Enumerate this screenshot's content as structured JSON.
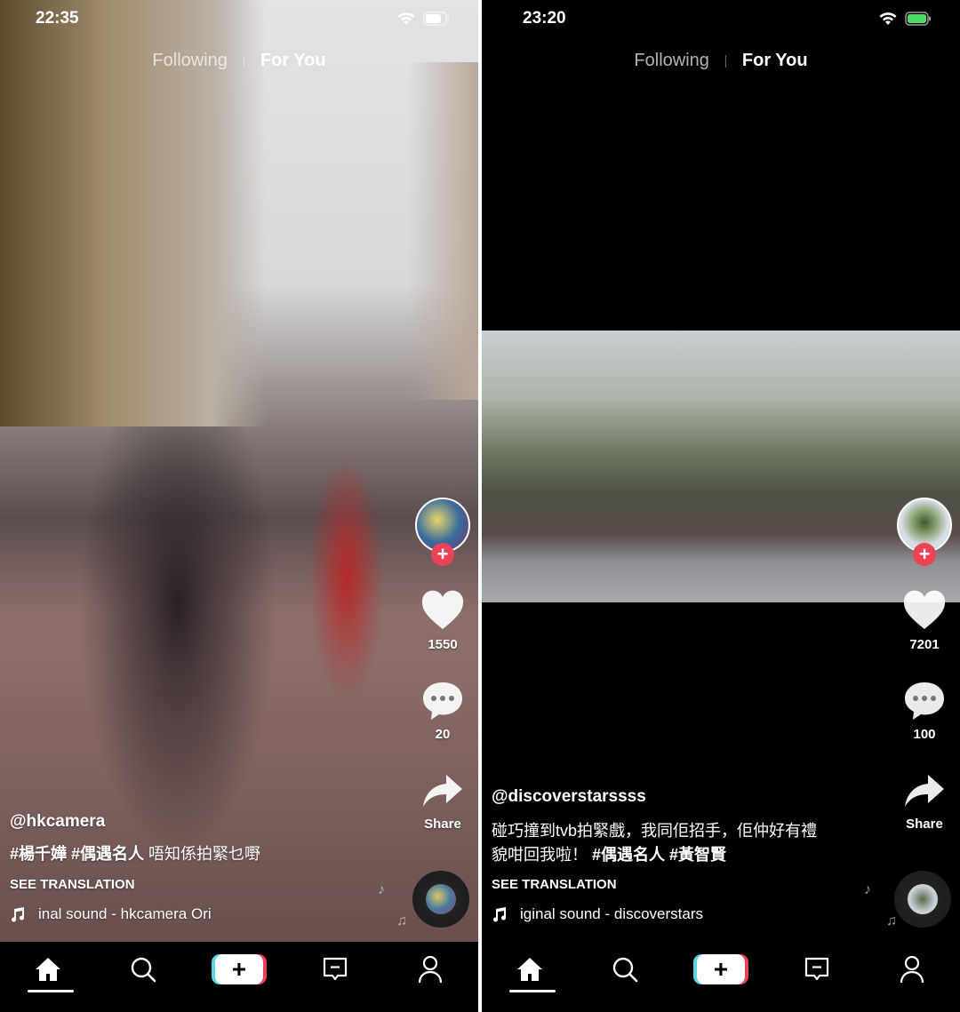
{
  "panels": [
    {
      "status": {
        "time": "22:35"
      },
      "tabs": {
        "following": "Following",
        "for_you": "For You"
      },
      "likes": "1550",
      "comments": "20",
      "share_label": "Share",
      "username": "@hkcamera",
      "caption_line1": "",
      "caption_plain": "",
      "caption_tags": "#楊千嬅 #偶遇名人",
      "caption_after": " 唔知係拍緊乜嘢",
      "see_translation": "SEE TRANSLATION",
      "sound": "inal sound - hkcamera    Ori",
      "background": "street-photo"
    },
    {
      "status": {
        "time": "23:20"
      },
      "tabs": {
        "following": "Following",
        "for_you": "For You"
      },
      "likes": "7201",
      "comments": "100",
      "share_label": "Share",
      "username": "@discoverstarssss",
      "caption_line1": "碰巧撞到tvb拍緊戲，我同佢招手，佢仲好有禮",
      "caption_plain": "貌咁回我啦！ ",
      "caption_tags": "#偶遇名人 #黃智賢",
      "caption_after": "",
      "see_translation": "SEE TRANSLATION",
      "sound": "iginal sound - discoverstars",
      "background": "letterboxed-video"
    }
  ],
  "colors": {
    "accent_red": "#ea4359",
    "accent_cyan": "#5ad6e0",
    "nav_bg": "#000000"
  },
  "nav_icons": [
    "home-icon",
    "search-icon",
    "create-icon",
    "inbox-icon",
    "profile-icon"
  ]
}
